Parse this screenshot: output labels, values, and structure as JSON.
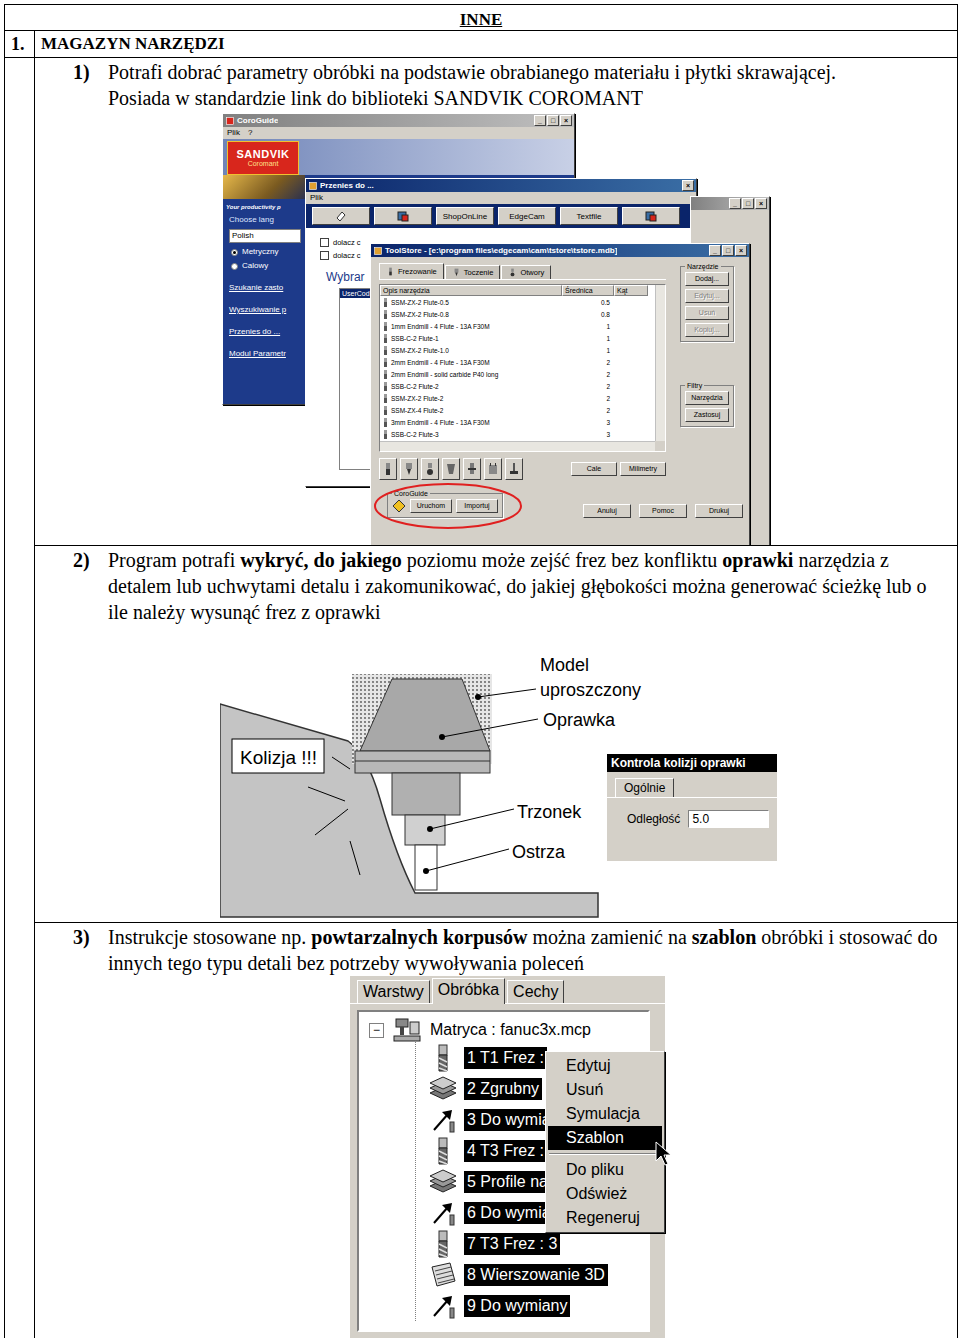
{
  "header": {
    "title": "INNE"
  },
  "chapter": {
    "number": "1.",
    "title": "MAGAZYN NARZĘDZI"
  },
  "section1": {
    "number": "1)",
    "paragraphs": [
      [
        {
          "text": "Potrafi dobrać parametry obróbki na podstawie obrabianego materiału i płytki skrawającej.",
          "bold": false
        }
      ],
      [
        {
          "text": "Posiada w standardzie link do biblioteki SANDVIK COROMANT",
          "bold": false
        }
      ]
    ],
    "coroguide": {
      "title": "CoroGuide",
      "active": false,
      "controls": [
        "_",
        "□",
        "×"
      ],
      "menu": [
        "Plik",
        "?"
      ],
      "logo": {
        "brand": "SANDVIK",
        "sub": "Coromant"
      },
      "tagline": "Your productivity p",
      "choose": "Choose lang",
      "language": "Polish",
      "units": [
        {
          "label": "Metryczny",
          "selected": true
        },
        {
          "label": "Calowy",
          "selected": false
        }
      ],
      "links": [
        "Szukanie zasto",
        "Wyszukiwanie p",
        "Przenies do ...",
        "Modul Parametr"
      ]
    },
    "przenies": {
      "title": "Przenies do ...",
      "active": true,
      "controls": [
        "×"
      ],
      "menu": [
        "Plik"
      ],
      "toolbar": [
        {
          "kind": "icon",
          "label": ""
        },
        {
          "kind": "icon",
          "label": ""
        },
        {
          "kind": "text",
          "label": "ShopOnLine"
        },
        {
          "kind": "text",
          "label": "EdgeCam"
        },
        {
          "kind": "text",
          "label": "Textfile"
        },
        {
          "kind": "icon",
          "label": ""
        }
      ],
      "checks": [
        {
          "label": "dolacz c",
          "checked": false
        },
        {
          "label": "dolacz c",
          "checked": false
        }
      ],
      "heading": "Wybrar",
      "list": [
        {
          "label": "UserCod",
          "selected": true
        }
      ]
    },
    "third": {
      "active": false,
      "controls": [
        "_",
        "□",
        "×"
      ]
    },
    "toolstore": {
      "title": "ToolStore - [e:\\program files\\edgecam\\cam\\tstore\\tstore.mdb]",
      "active": true,
      "controls": [
        "_",
        "□",
        "×"
      ],
      "tabs": [
        {
          "label": "Frezowanie",
          "selected": true
        },
        {
          "label": "Toczenie",
          "selected": false
        },
        {
          "label": "Otwory",
          "selected": false
        }
      ],
      "columns": [
        "Opis narzędzia",
        "Średnica",
        "Kąt"
      ],
      "rows": [
        {
          "name": "SSM-ZX-2 Flute-0.5",
          "diameter": "0.5"
        },
        {
          "name": "SSM-ZX-2 Flute-0.8",
          "diameter": "0.8"
        },
        {
          "name": "1mm Endmill - 4 Flute - 13A F30M",
          "diameter": "1"
        },
        {
          "name": "SSB-C-2 Flute-1",
          "diameter": "1"
        },
        {
          "name": "SSM-ZX-2 Flute-1.0",
          "diameter": "1"
        },
        {
          "name": "2mm Endmill - 4 Flute - 13A F30M",
          "diameter": "2"
        },
        {
          "name": "2mm Endmill - solid carbide P40 long",
          "diameter": "2"
        },
        {
          "name": "SSB-C-2 Flute-2",
          "diameter": "2"
        },
        {
          "name": "SSM-ZX-2 Flute-2",
          "diameter": "2"
        },
        {
          "name": "SSM-ZX-4 Flute-2",
          "diameter": "2"
        },
        {
          "name": "3mm Endmill - 4 Flute - 13A F30M",
          "diameter": "3"
        },
        {
          "name": "SSB-C-2 Flute-3",
          "diameter": "3"
        }
      ],
      "toolGroup": {
        "label": "Narzędzie",
        "buttons": [
          {
            "label": "Dodaj...",
            "disabled": false
          },
          {
            "label": "Edytuj...",
            "disabled": true
          },
          {
            "label": "Usuń",
            "disabled": true
          },
          {
            "label": "Kopiuj...",
            "disabled": true
          }
        ]
      },
      "filterGroup": {
        "label": "Filtry",
        "buttons": [
          {
            "label": "Narzędzia",
            "disabled": false
          },
          {
            "label": "Zastosuj",
            "disabled": false
          }
        ]
      },
      "units": [
        "Cale",
        "Milimetry"
      ],
      "coroGroup": {
        "label": "CoroGuide",
        "buttons": [
          "Uruchom",
          "Importuj"
        ]
      },
      "footer": [
        "Anuluj",
        "Pomoc",
        "Drukuj"
      ]
    }
  },
  "section2": {
    "number": "2)",
    "paragraphs": [
      [
        {
          "text": "Program potrafi ",
          "bold": false
        },
        {
          "text": "wykryć, do jakiego",
          "bold": true
        },
        {
          "text": " poziomu może zejść frez bez konfliktu ",
          "bold": false
        },
        {
          "text": "oprawki",
          "bold": true
        },
        {
          "text": " narzędzia z detalem lub uchwytami detalu i zakomunikować, do jakiej głębokości można generować ścieżkę lub o ile należy wysunąć frez z oprawki",
          "bold": false
        }
      ]
    ],
    "diagram": {
      "alert": "Kolizja !!!",
      "model": [
        "Model",
        "uproszczony"
      ],
      "holder": "Oprawka",
      "shank": "Trzonek",
      "blade": "Ostrza"
    },
    "dialog": {
      "title": "Kontrola kolizji oprawki",
      "tabs": [
        {
          "label": "Ogólnie",
          "selected": true
        }
      ],
      "field": {
        "label": "Odległość",
        "value": "5.0"
      }
    }
  },
  "section3": {
    "number": "3)",
    "paragraphs": [
      [
        {
          "text": "Instrukcje stosowane np. ",
          "bold": false
        },
        {
          "text": "powtarzalnych korpusów",
          "bold": true
        },
        {
          "text": " można zamienić na ",
          "bold": false
        },
        {
          "text": "szablon",
          "bold": true
        },
        {
          "text": " obróbki i stosować do innych tego typu detali bez potrzeby wywoływania poleceń",
          "bold": false
        }
      ]
    ],
    "panel": {
      "tabs": [
        {
          "label": "Warstwy",
          "selected": false
        },
        {
          "label": "Obróbka",
          "selected": true
        },
        {
          "label": "Cechy",
          "selected": false
        }
      ],
      "root": {
        "label": "Matryca : fanuc3x.mcp",
        "toggle": "−",
        "expanded": true
      },
      "items": [
        {
          "label": "1 T1 Frez :",
          "kind": "tool",
          "selected": true
        },
        {
          "label": "2 Zgrubny",
          "kind": "roughing",
          "selected": true
        },
        {
          "label": "3 Do wymia",
          "kind": "change",
          "selected": true
        },
        {
          "label": "4 T3 Frez :",
          "kind": "tool",
          "selected": true
        },
        {
          "label": "5 Profile na",
          "kind": "roughing",
          "selected": true
        },
        {
          "label": "6 Do wymia",
          "kind": "change",
          "selected": true
        },
        {
          "label": "7 T3 Frez : 3",
          "kind": "tool",
          "selected": true
        },
        {
          "label": "8 Wierszowanie 3D",
          "kind": "raster",
          "selected": true
        },
        {
          "label": "9 Do wymiany",
          "kind": "change",
          "selected": true
        }
      ],
      "menu": [
        [
          {
            "label": "Edytuj",
            "selected": false
          },
          {
            "label": "Usuń",
            "selected": false
          },
          {
            "label": "Symulacja",
            "selected": false
          },
          {
            "label": "Szablon",
            "selected": true
          }
        ],
        [
          {
            "label": "Do pliku",
            "selected": false
          },
          {
            "label": "Odśwież",
            "selected": false
          },
          {
            "label": "Regeneruj",
            "selected": false
          }
        ]
      ]
    }
  }
}
